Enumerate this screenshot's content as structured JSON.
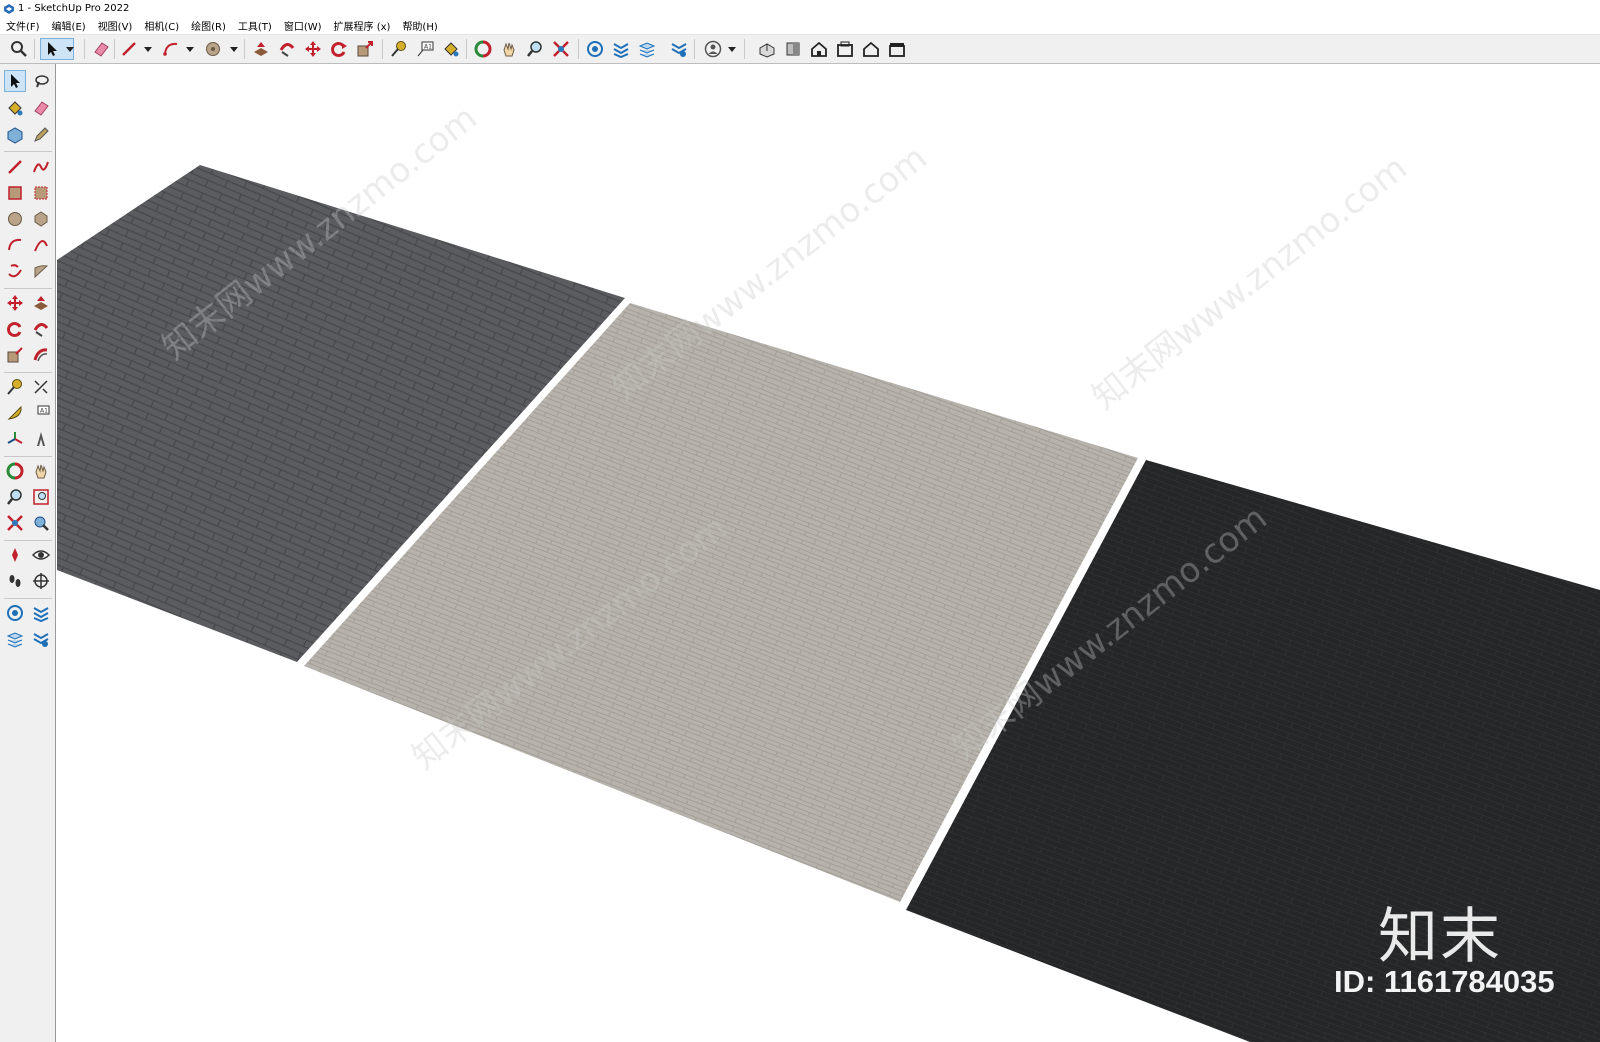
{
  "window": {
    "title": "1 - SketchUp Pro 2022"
  },
  "menu": {
    "items": [
      "文件(F)",
      "编辑(E)",
      "视图(V)",
      "相机(C)",
      "绘图(R)",
      "工具(T)",
      "窗口(W)",
      "扩展程序 (x)",
      "帮助(H)"
    ]
  },
  "colors": {
    "tile_dark_gray": "#5b5c60",
    "tile_light_gray": "#b7b3ac",
    "tile_black": "#252627",
    "selection_blue": "#cde4f7",
    "toolbar_bg": "#f0f0f0"
  },
  "watermark": {
    "brand": "知末",
    "id": "ID: 1161784035",
    "diagonal_text": "知末网www.znzmo.com"
  }
}
